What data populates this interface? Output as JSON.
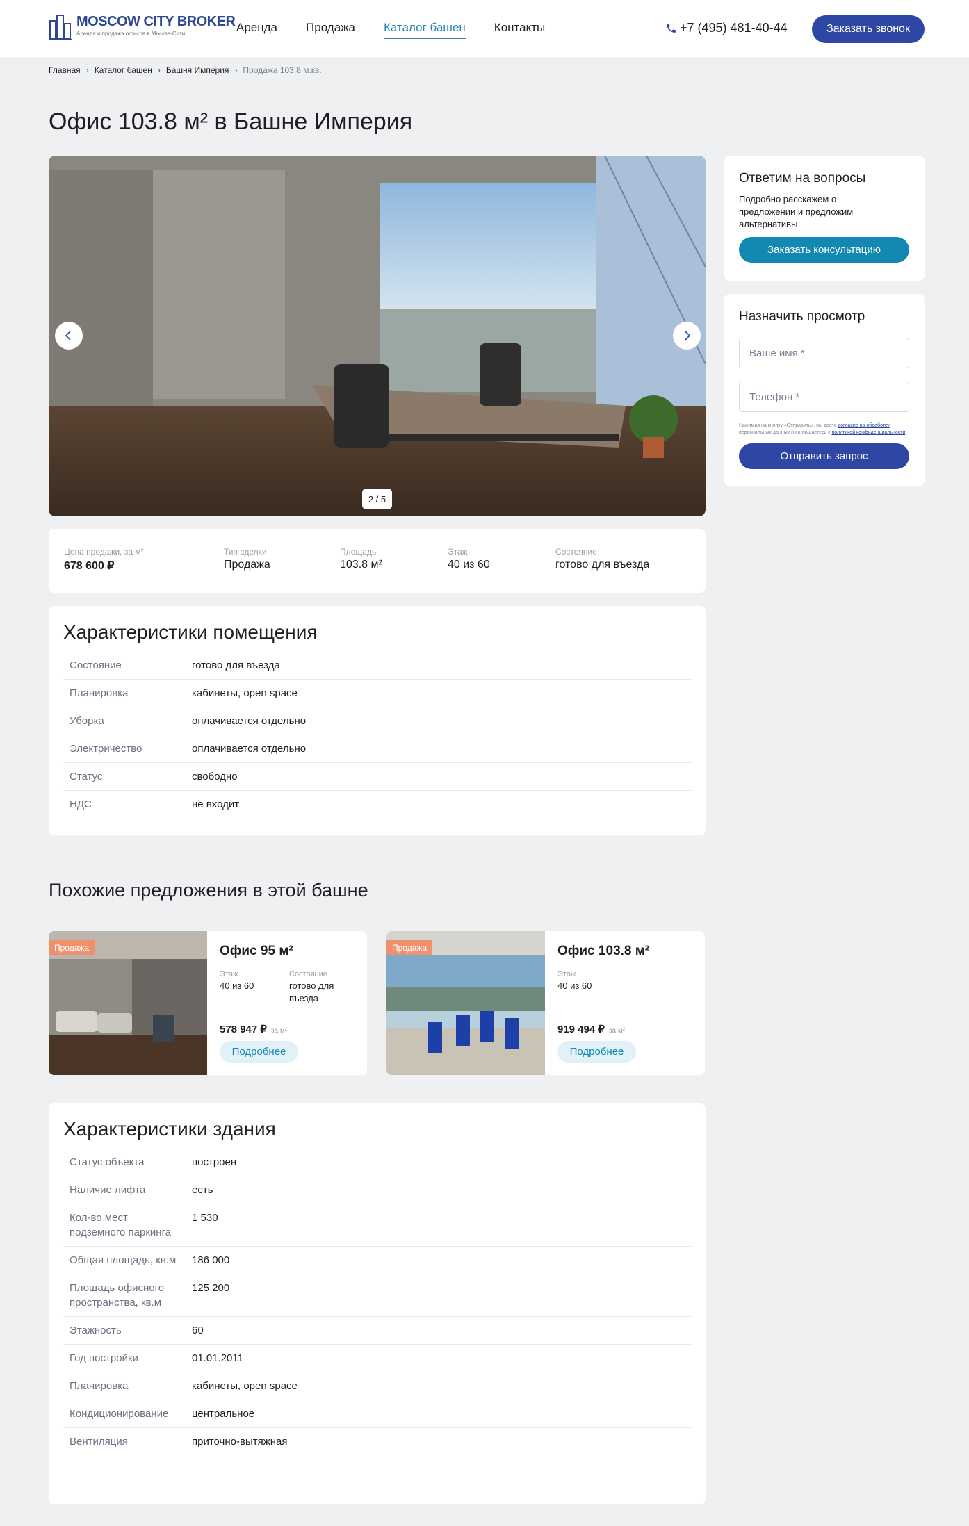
{
  "header": {
    "logo_title": "MOSCOW CITY BROKER",
    "logo_subtitle": "Аренда и продажа офисов в Москва-Сити",
    "nav": [
      "Аренда",
      "Продажа",
      "Каталог башен",
      "Контакты"
    ],
    "phone": "+7 (495) 481-40-44",
    "callback_label": "Заказать звонок"
  },
  "breadcrumb": [
    "Главная",
    "Каталог башен",
    "Башня Империя",
    "Продажа 103.8 м.кв."
  ],
  "page_title": "Офис 103.8 м² в Башне Империя",
  "gallery": {
    "counter": "2 / 5"
  },
  "sidebar": {
    "consult": {
      "title": "Ответим на вопросы",
      "text": "Подробно расскажем о предложении и предложим альтернативы",
      "button": "Заказать консультацию"
    },
    "viewing": {
      "title": "Назначить просмотр",
      "name_placeholder": "Ваше имя *",
      "phone_placeholder": "Телефон *",
      "consent_prefix": "Нажимая на кнопку «Отправить», вы даете",
      "consent_link1": "согласие на обработку",
      "consent_middle": "персональных данных и соглашаетесь c",
      "consent_link2": "политикой конфиденциальности",
      "button": "Отправить запрос"
    }
  },
  "summary": [
    {
      "label": "Цена продажи, за м²",
      "value": "678 600 ₽"
    },
    {
      "label": "Тип сделки",
      "value": "Продажа"
    },
    {
      "label": "Площадь",
      "value": "103.8 м²"
    },
    {
      "label": "Этаж",
      "value": "40 из 60"
    },
    {
      "label": "Состояние",
      "value": "готово для въезда"
    }
  ],
  "room_specs": {
    "title": "Характеристики помещения",
    "rows": [
      {
        "key": "Состояние",
        "value": "готово для въезда"
      },
      {
        "key": "Планировка",
        "value": "кабинеты, open space"
      },
      {
        "key": "Уборка",
        "value": "оплачивается отдельно"
      },
      {
        "key": "Электричество",
        "value": "оплачивается отдельно"
      },
      {
        "key": "Статус",
        "value": "свободно"
      },
      {
        "key": "НДС",
        "value": "не входит"
      }
    ]
  },
  "similar": {
    "title": "Похожие предложения в этой башне",
    "offers": [
      {
        "badge": "Продажа",
        "title": "Офис 95 м²",
        "floor_label": "Этаж",
        "floor": "40 из 60",
        "state_label": "Состояние",
        "state": "готово для въезда",
        "price": "578 947 ₽",
        "per": "за м²",
        "button": "Подробнее"
      },
      {
        "badge": "Продажа",
        "title": "Офис 103.8 м²",
        "floor_label": "Этаж",
        "floor": "40 из 60",
        "price": "919 494 ₽",
        "per": "за м²",
        "button": "Подробнее"
      }
    ]
  },
  "building_specs": {
    "title": "Характеристики здания",
    "rows": [
      {
        "key": "Статус объекта",
        "value": "построен"
      },
      {
        "key": "Наличие лифта",
        "value": "есть"
      },
      {
        "key": "Кол-во мест подземного паркинга",
        "value": "1 530"
      },
      {
        "key": "Общая площадь, кв.м",
        "value": "186 000"
      },
      {
        "key": "Площадь офисного пространства, кв.м",
        "value": "125 200"
      },
      {
        "key": "Этажность",
        "value": "60"
      },
      {
        "key": "Год постройки",
        "value": "01.01.2011"
      },
      {
        "key": "Планировка",
        "value": "кабинеты, open space"
      },
      {
        "key": "Кондиционирование",
        "value": "центральное"
      },
      {
        "key": "Вентиляция",
        "value": "приточно-вытяжная"
      }
    ]
  },
  "colors": {
    "brand": "#2e47a4",
    "accent": "#1388b3",
    "badge": "#f0916d",
    "background": "#eff0f2"
  }
}
